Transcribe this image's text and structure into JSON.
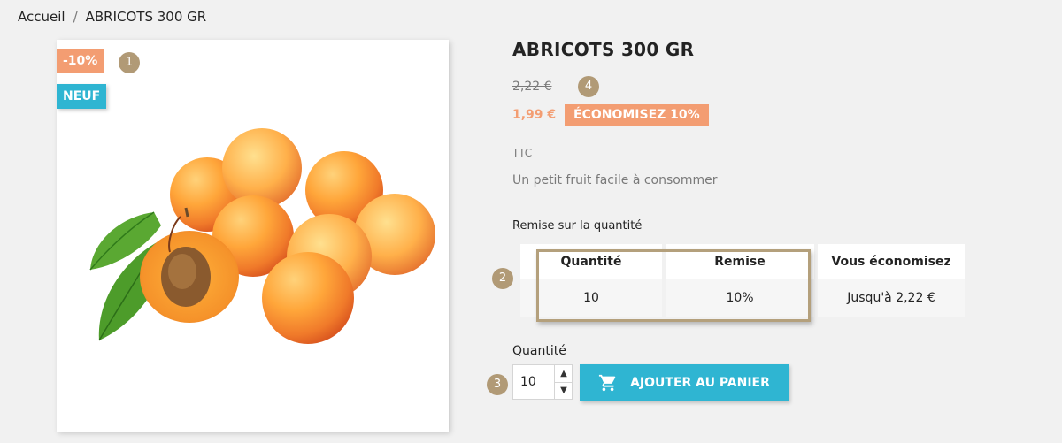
{
  "breadcrumb": {
    "home": "Accueil",
    "separator": "/",
    "current": "ABRICOTS 300 GR"
  },
  "product_image": {
    "flags": {
      "discount": "-10%",
      "new": "NEUF"
    }
  },
  "annotations": {
    "one": "1",
    "two": "2",
    "three": "3",
    "four": "4"
  },
  "product": {
    "title": "ABRICOTS 300 GR",
    "old_price": "2,22 €",
    "price": "1,99 €",
    "save_badge": "ÉCONOMISEZ 10%",
    "tax_label": "TTC",
    "description": "Un petit fruit facile à consommer"
  },
  "volume_discount": {
    "label": "Remise sur la quantité",
    "headers": [
      "Quantité",
      "Remise",
      "Vous économisez"
    ],
    "rows": [
      [
        "10",
        "10%",
        "Jusqu'à 2,22 €"
      ]
    ]
  },
  "quantity": {
    "label": "Quantité",
    "value": "10"
  },
  "add_to_cart": {
    "label": "AJOUTER AU PANIER"
  },
  "colors": {
    "accent": "#2fb5d2",
    "discount": "#f39d72",
    "annotation": "#b19a76"
  }
}
